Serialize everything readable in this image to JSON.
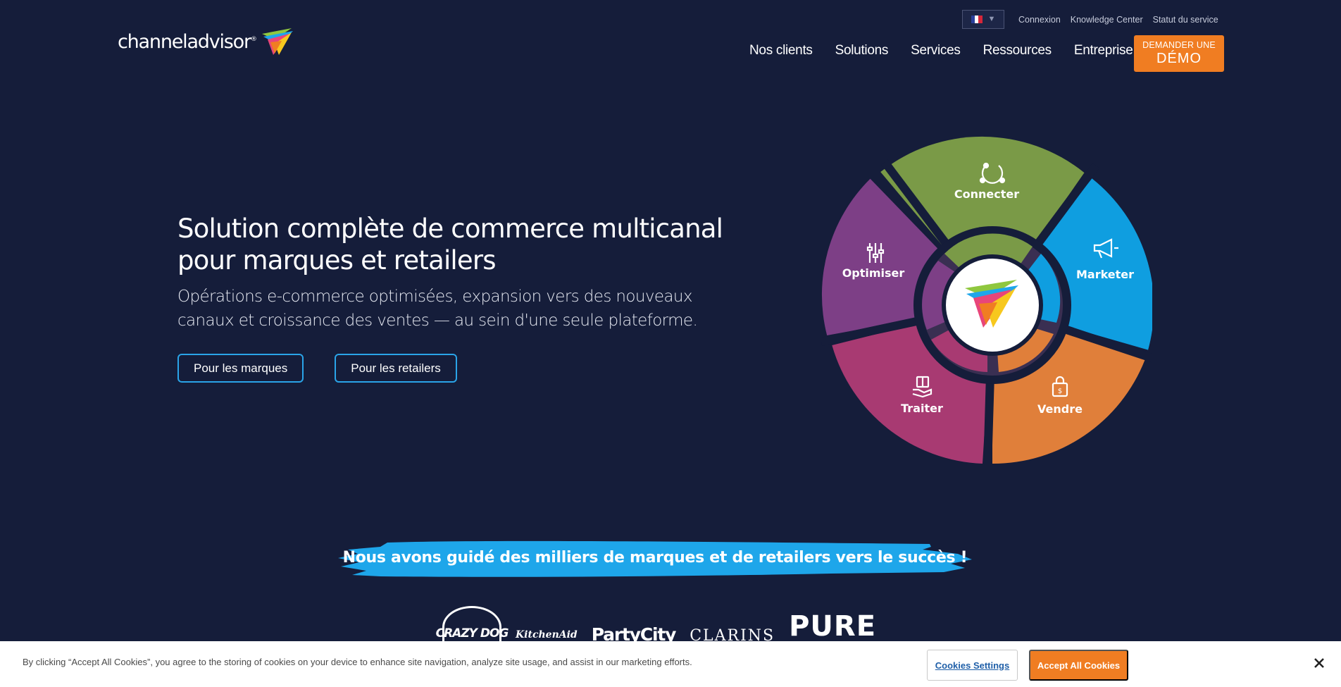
{
  "header": {
    "language": {
      "selected_flag": "french-flag-icon",
      "caret": "▼"
    },
    "utility_links": [
      "Connexion",
      "Knowledge Center",
      "Statut du service"
    ],
    "logo": {
      "text": "channeladvisor",
      "registered": "®"
    },
    "nav": [
      "Nos clients",
      "Solutions",
      "Services",
      "Ressources",
      "Entreprise"
    ],
    "search_icon": "search-icon",
    "demo_button": {
      "line1": "DEMANDER UNE",
      "line2": "DÉMO"
    }
  },
  "hero": {
    "title": "Solution complète de commerce multicanal pour marques et retailers",
    "subtitle": "Opérations e-commerce optimisées, expansion vers des nouveaux canaux et croissance des ventes — au sein d'une seule plateforme.",
    "buttons": [
      "Pour les marques",
      "Pour les retailers"
    ]
  },
  "wheel": {
    "segments": [
      {
        "label": "Connecter",
        "icon": "connect-cycle-icon",
        "color": "#7a9a47"
      },
      {
        "label": "Marketer",
        "icon": "megaphone-icon",
        "color": "#0f9ee0"
      },
      {
        "label": "Vendre",
        "icon": "shopping-bag-icon",
        "color": "#e07f3a"
      },
      {
        "label": "Traiter",
        "icon": "package-hand-icon",
        "color": "#a83a72"
      },
      {
        "label": "Optimiser",
        "icon": "sliders-icon",
        "color": "#7d3f86"
      }
    ],
    "center_icon": "channeladvisor-mark-icon"
  },
  "banner": {
    "text": "Nous avons guidé des milliers de marques et de retailers vers le succès !",
    "color": "#1ea6ea"
  },
  "clients": [
    "CRAZY DOG",
    "KitchenAid",
    "PartyCity",
    "CLARINS",
    "PURE"
  ],
  "cookie": {
    "text": "By clicking “Accept All Cookies”, you agree to the storing of cookies on your device to enhance site navigation, analyze site usage, and assist in our marketing efforts.",
    "settings_label": "Cookies Settings",
    "accept_label": "Accept All Cookies",
    "close_icon": "close-icon"
  },
  "colors": {
    "background": "#151d3a",
    "accent_orange": "#f07d22",
    "accent_blue": "#2aa4e8"
  }
}
